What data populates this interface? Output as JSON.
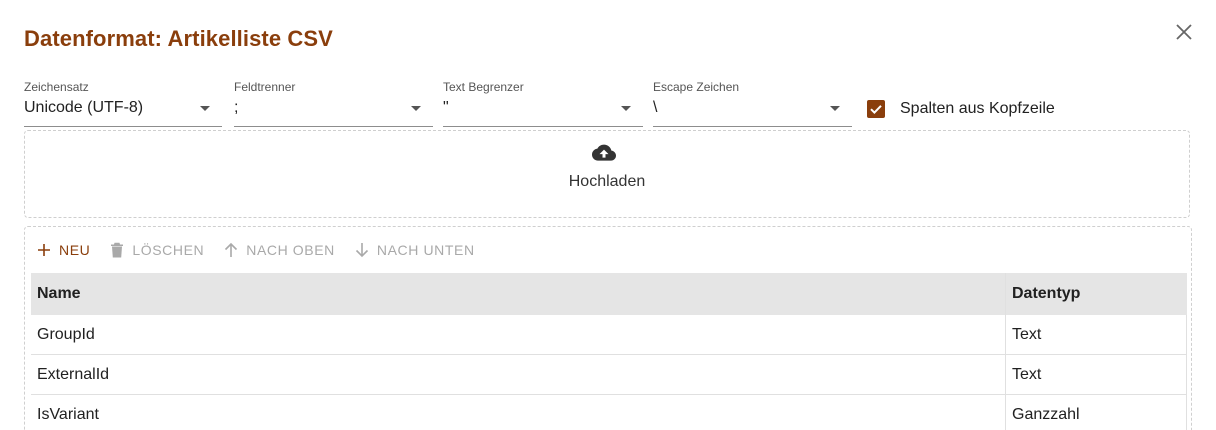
{
  "dialog": {
    "title": "Datenformat: Artikelliste CSV"
  },
  "fields": {
    "charset": {
      "label": "Zeichensatz",
      "value": "Unicode (UTF-8)"
    },
    "separator": {
      "label": "Feldtrenner",
      "value": ";"
    },
    "text_delimiter": {
      "label": "Text Begrenzer",
      "value": "\""
    },
    "escape": {
      "label": "Escape Zeichen",
      "value": "\\"
    }
  },
  "header_checkbox": {
    "label": "Spalten aus Kopfzeile",
    "checked": true
  },
  "upload": {
    "label": "Hochladen"
  },
  "toolbar": {
    "new_label": "NEU",
    "delete_label": "LÖSCHEN",
    "up_label": "NACH OBEN",
    "down_label": "NACH UNTEN"
  },
  "table": {
    "headers": {
      "name": "Name",
      "type": "Datentyp"
    },
    "rows": [
      {
        "name": "GroupId",
        "type": "Text"
      },
      {
        "name": "ExternalId",
        "type": "Text"
      },
      {
        "name": "IsVariant",
        "type": "Ganzzahl"
      }
    ]
  },
  "colors": {
    "accent": "#8a3e0c",
    "disabled": "#a9a9a9"
  },
  "icons": {
    "close": "close-icon",
    "upload": "cloud-upload-icon",
    "new": "plus-icon",
    "delete": "trash-icon",
    "up": "arrow-up-icon",
    "down": "arrow-down-icon",
    "check": "check-icon"
  }
}
